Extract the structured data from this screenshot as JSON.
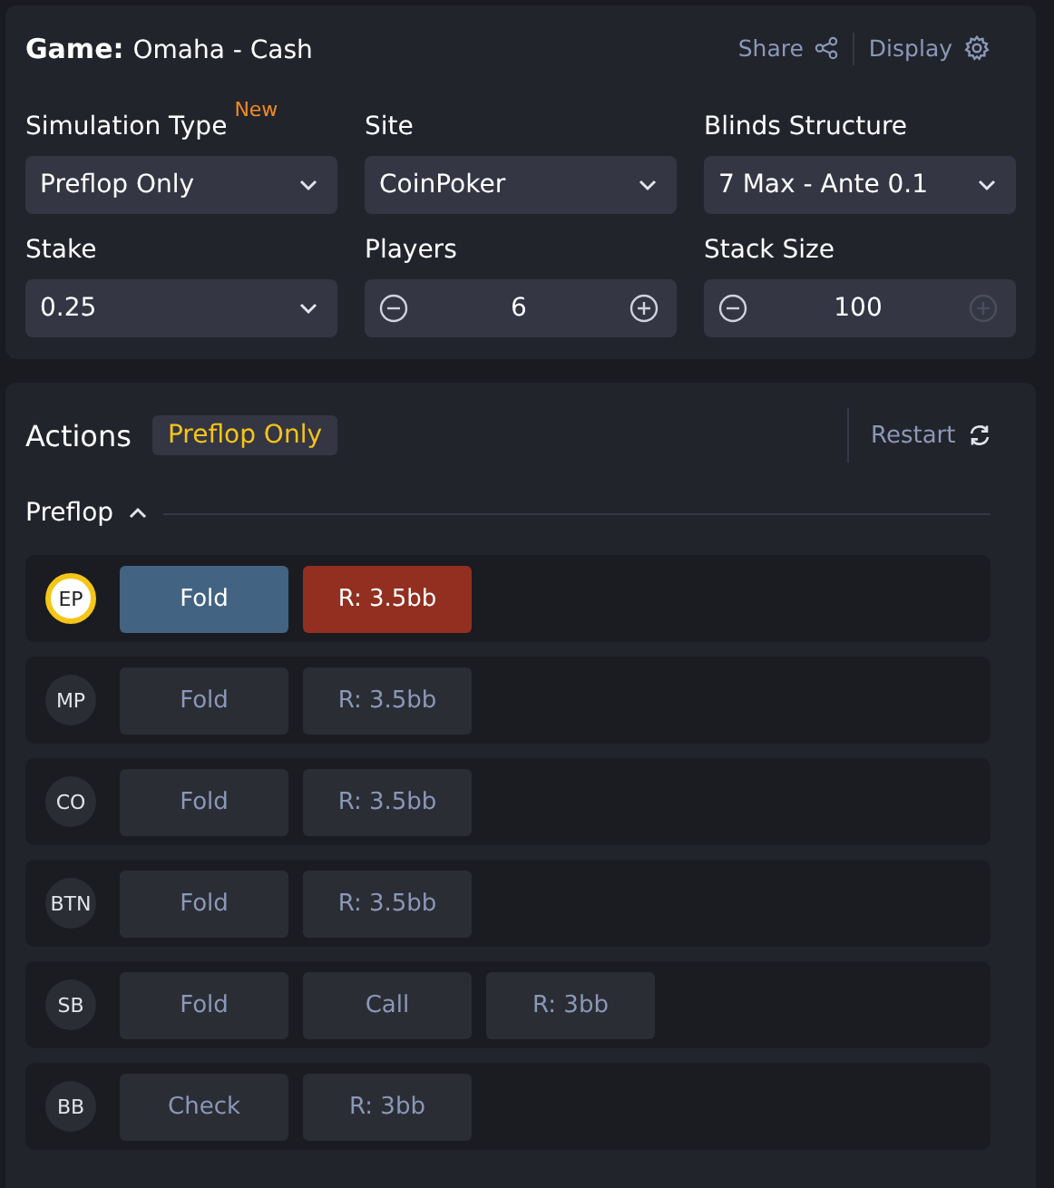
{
  "header": {
    "label": "Game:",
    "value": "Omaha - Cash",
    "share": "Share",
    "display": "Display"
  },
  "settings": [
    {
      "label": "Simulation Type",
      "badge": "New",
      "kind": "select",
      "value": "Preflop Only"
    },
    {
      "label": "Site",
      "kind": "select",
      "value": "CoinPoker"
    },
    {
      "label": "Blinds Structure",
      "kind": "select",
      "value": "7 Max - Ante 0.1"
    },
    {
      "label": "Stake",
      "kind": "select",
      "value": "0.25"
    },
    {
      "label": "Players",
      "kind": "stepper",
      "value": "6",
      "minus_disabled": false,
      "plus_disabled": false
    },
    {
      "label": "Stack Size",
      "kind": "stepper",
      "value": "100",
      "minus_disabled": false,
      "plus_disabled": true
    }
  ],
  "actions": {
    "title": "Actions",
    "tag": "Preflop Only",
    "restart": "Restart",
    "street": "Preflop",
    "expanded": true,
    "rows": [
      {
        "position": "EP",
        "active": true,
        "buttons": [
          {
            "label": "Fold",
            "kind": "fold"
          },
          {
            "label": "R: 3.5bb",
            "kind": "raise"
          }
        ]
      },
      {
        "position": "MP",
        "active": false,
        "buttons": [
          {
            "label": "Fold",
            "kind": "fold"
          },
          {
            "label": "R: 3.5bb",
            "kind": "raise"
          }
        ]
      },
      {
        "position": "CO",
        "active": false,
        "buttons": [
          {
            "label": "Fold",
            "kind": "fold"
          },
          {
            "label": "R: 3.5bb",
            "kind": "raise"
          }
        ]
      },
      {
        "position": "BTN",
        "active": false,
        "buttons": [
          {
            "label": "Fold",
            "kind": "fold"
          },
          {
            "label": "R: 3.5bb",
            "kind": "raise"
          }
        ]
      },
      {
        "position": "SB",
        "active": false,
        "buttons": [
          {
            "label": "Fold",
            "kind": "fold"
          },
          {
            "label": "Call",
            "kind": "call"
          },
          {
            "label": "R: 3bb",
            "kind": "raise"
          }
        ]
      },
      {
        "position": "BB",
        "active": false,
        "buttons": [
          {
            "label": "Check",
            "kind": "check"
          },
          {
            "label": "R: 3bb",
            "kind": "raise"
          }
        ]
      }
    ]
  }
}
